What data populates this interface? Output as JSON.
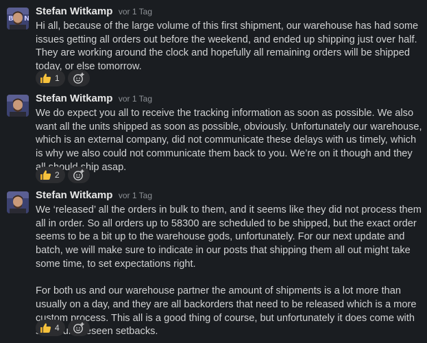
{
  "messages": [
    {
      "author": "Stefan Witkamp",
      "time": "vor 1 Tag",
      "paragraphs": [
        "Hi all, because of the large volume of this first shipment, our warehouse has had some issues getting all orders out before the weekend, and ended up shipping just over half. They are working around the clock and hopefully all remaining orders will be shipped today, or else tomorrow."
      ],
      "reaction": {
        "emoji": "thumbs-up-icon",
        "count": "1"
      },
      "add_reaction": "add-reaction-icon"
    },
    {
      "author": "Stefan Witkamp",
      "time": "vor 1 Tag",
      "paragraphs": [
        "We do expect you all to receive the tracking information as soon as possible. We also want all the units shipped as soon as possible, obviously. Unfortunately our warehouse, which is an external company, did not communicate these delays with us timely, which is why we also could not communicate them back to you. We’re on it though and they all should ship asap."
      ],
      "reaction": {
        "emoji": "thumbs-up-icon",
        "count": "2"
      },
      "add_reaction": "add-reaction-icon"
    },
    {
      "author": "Stefan Witkamp",
      "time": "vor 1 Tag",
      "paragraphs": [
        "We ‘released’ all the orders in bulk to them, and it seems like they did not process them all in order. So all orders up to 58300 are scheduled to be shipped, but the exact order seems to be a bit up to the warehouse gods, unfortunately. For our next update and batch, we will make sure to indicate in our posts that shipping them all out might take some time, to set expectations right.",
        "For both us and our warehouse partner the amount of shipments is a lot more than usually on a day, and they are all backorders that need to be released which is a more custom process. This all is a good thing of course, but unfortunately it does come with some unforeseen setbacks."
      ],
      "reaction": {
        "emoji": "thumbs-up-icon",
        "count": "4"
      },
      "add_reaction": "add-reaction-icon"
    }
  ],
  "colors": {
    "background": "#1a1d21",
    "text": "#d1d2d3",
    "author": "#e8e8e8",
    "timestamp": "#8e9297",
    "reaction_pill": "#2c2d30",
    "thumbs_up": "#f7c23c"
  }
}
